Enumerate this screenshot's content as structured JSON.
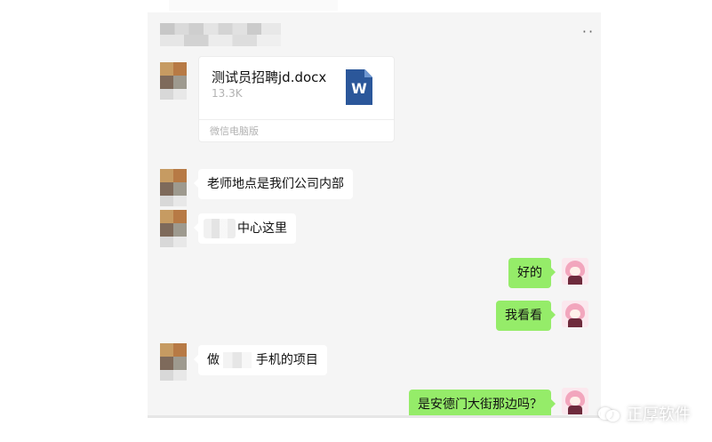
{
  "header": {
    "more_label": "··"
  },
  "messages": [
    {
      "side": "left",
      "type": "file",
      "file": {
        "name": "测试员招聘jd.docx",
        "size": "13.3K",
        "source": "微信电脑版",
        "icon": "word-icon"
      }
    },
    {
      "side": "left",
      "type": "text",
      "text": "老师地点是我们公司内部"
    },
    {
      "side": "left",
      "type": "text",
      "text": "中心这里"
    },
    {
      "side": "right",
      "type": "text",
      "text": "好的"
    },
    {
      "side": "right",
      "type": "text",
      "text": "我看看"
    },
    {
      "side": "left",
      "type": "text",
      "text": "做",
      "text_rest": "手机的项目"
    },
    {
      "side": "right",
      "type": "text",
      "text": "是安德门大街那边吗？"
    }
  ],
  "watermark": {
    "label": "正厚软件",
    "icon": "wechat-icon"
  },
  "colors": {
    "sent_bubble": "#95ec69",
    "received_bubble": "#ffffff",
    "chat_bg": "#f5f5f5",
    "word_blue": "#2b579a"
  }
}
